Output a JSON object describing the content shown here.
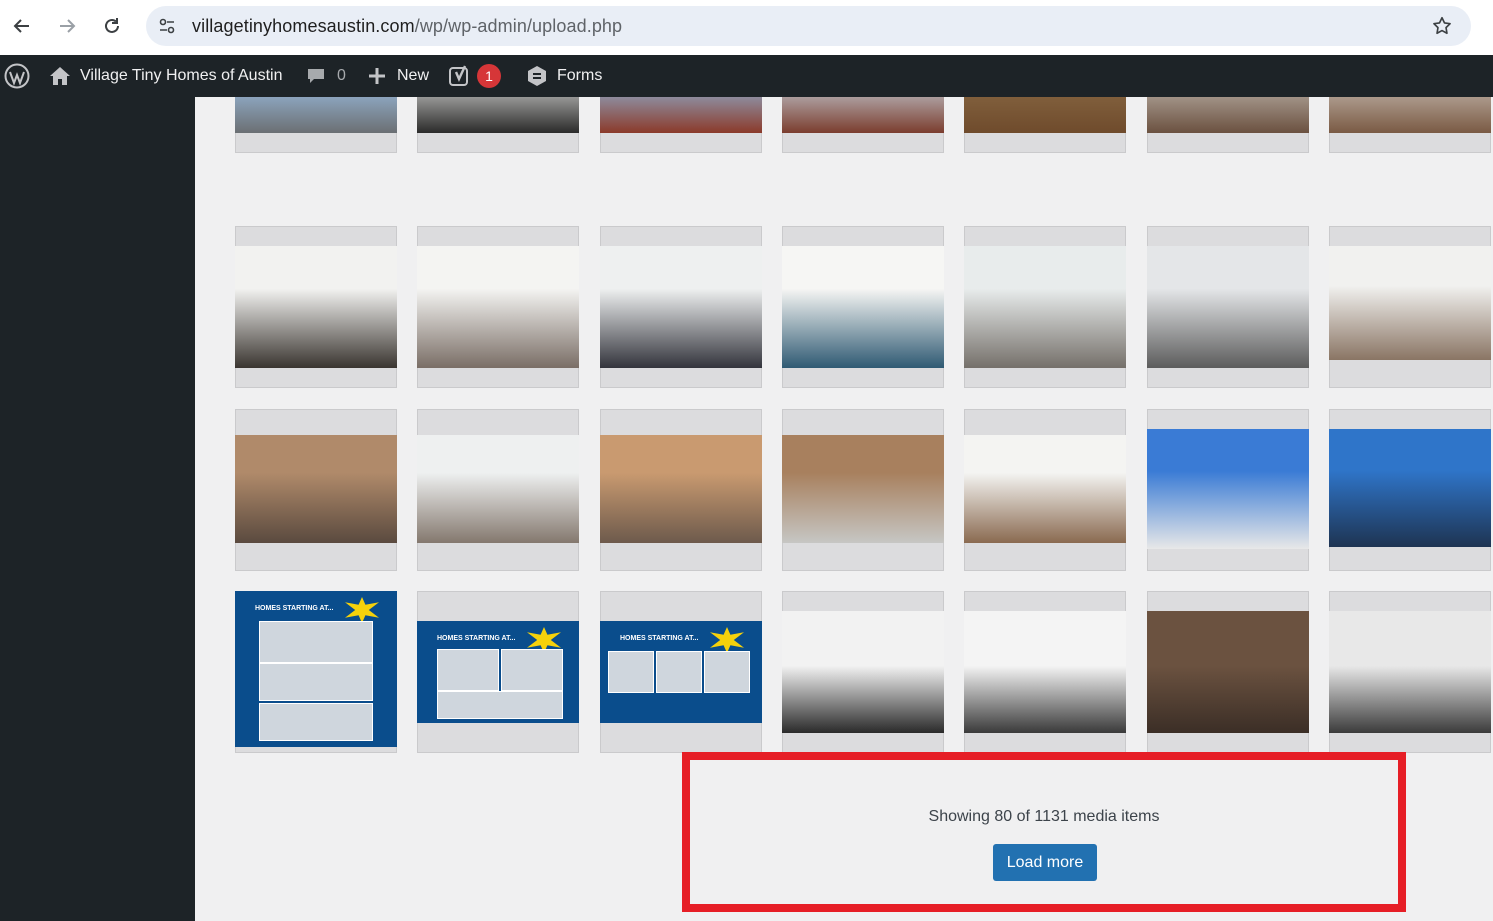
{
  "browser": {
    "url_host": "villagetinyhomesaustin.com",
    "url_path": "/wp/wp-admin/upload.php"
  },
  "adminbar": {
    "site_name": "Village Tiny Homes of Austin",
    "comments_count": "0",
    "new_label": "New",
    "yoast_badge": "1",
    "forms_label": "Forms"
  },
  "media": {
    "status_text": "Showing 80 of 1131 media items",
    "load_more_label": "Load more"
  },
  "flyers": {
    "headline": "HOMES STARTING AT..."
  }
}
